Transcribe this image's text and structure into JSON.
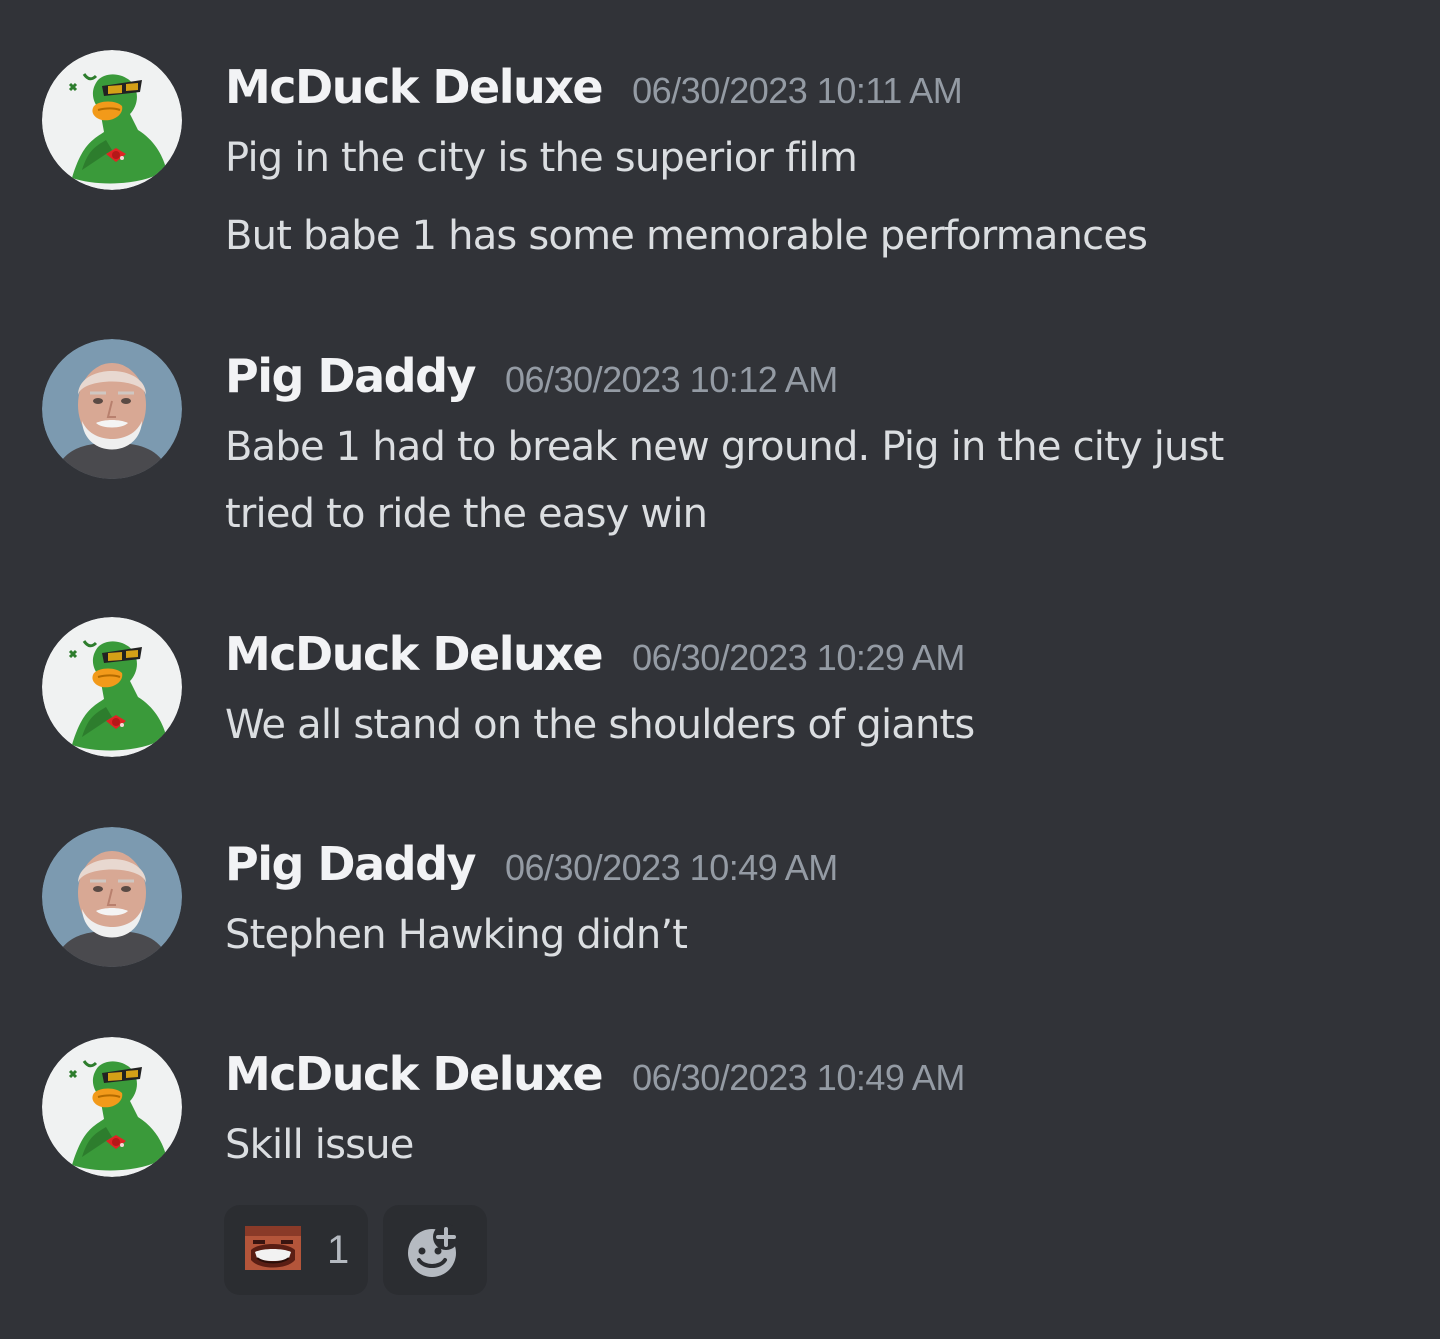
{
  "messages": [
    {
      "author": "McDuck Deluxe",
      "avatar": "duck-avatar",
      "timestamp": "06/30/2023 10:11 AM",
      "lines": [
        "Pig in the city is the superior film",
        "But babe 1 has some memorable performances"
      ]
    },
    {
      "author": "Pig Daddy",
      "avatar": "old-man-avatar",
      "timestamp": "06/30/2023 10:12 AM",
      "lines": [
        "Babe 1 had to break new ground. Pig in the city just",
        "tried to ride the easy win"
      ]
    },
    {
      "author": "McDuck Deluxe",
      "avatar": "duck-avatar",
      "timestamp": "06/30/2023 10:29 AM",
      "lines": [
        "We all stand on the shoulders of giants"
      ]
    },
    {
      "author": "Pig Daddy",
      "avatar": "old-man-avatar",
      "timestamp": "06/30/2023 10:49 AM",
      "lines": [
        "Stephen Hawking didn’t"
      ]
    },
    {
      "author": "McDuck Deluxe",
      "avatar": "duck-avatar",
      "timestamp": "06/30/2023 10:49 AM",
      "lines": [
        "Skill issue"
      ],
      "reactions": [
        {
          "emoji": "laughing-face-emoji",
          "count": "1"
        }
      ]
    }
  ],
  "add_reaction": {
    "icon": "add-emoji-icon"
  },
  "colors": {
    "background": "#313338",
    "username": "#f2f3f5",
    "timestamp": "#949ba4",
    "text": "#dbdee1",
    "reaction_bg": "#2b2d31"
  }
}
